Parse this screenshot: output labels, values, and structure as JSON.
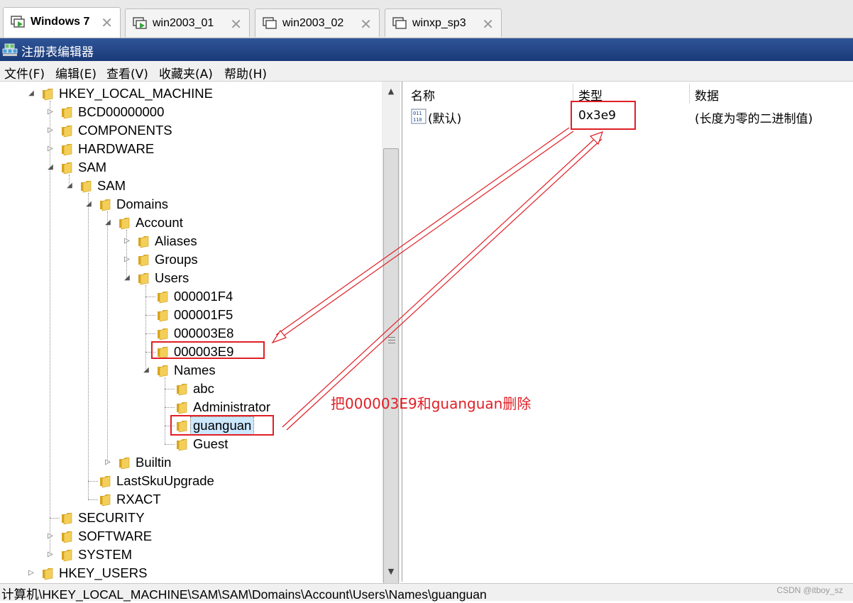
{
  "vm_tabs": [
    {
      "label": "Windows 7",
      "active": true
    },
    {
      "label": "win2003_01",
      "active": false
    },
    {
      "label": "win2003_02",
      "active": false
    },
    {
      "label": "winxp_sp3",
      "active": false
    }
  ],
  "window": {
    "title": "注册表编辑器"
  },
  "menu": [
    "文件(F)",
    "编辑(E)",
    "查看(V)",
    "收藏夹(A)",
    "帮助(H)"
  ],
  "tree": {
    "nodes": [
      {
        "label": "HKEY_LOCAL_MACHINE",
        "depth": 0,
        "expander": "expanded"
      },
      {
        "label": "BCD00000000",
        "depth": 1,
        "expander": "collapsed"
      },
      {
        "label": "COMPONENTS",
        "depth": 1,
        "expander": "collapsed"
      },
      {
        "label": "HARDWARE",
        "depth": 1,
        "expander": "collapsed"
      },
      {
        "label": "SAM",
        "depth": 1,
        "expander": "expanded"
      },
      {
        "label": "SAM",
        "depth": 2,
        "expander": "expanded"
      },
      {
        "label": "Domains",
        "depth": 3,
        "expander": "expanded"
      },
      {
        "label": "Account",
        "depth": 4,
        "expander": "expanded"
      },
      {
        "label": "Aliases",
        "depth": 5,
        "expander": "collapsed"
      },
      {
        "label": "Groups",
        "depth": 5,
        "expander": "collapsed"
      },
      {
        "label": "Users",
        "depth": 5,
        "expander": "expanded"
      },
      {
        "label": "000001F4",
        "depth": 6,
        "expander": "none"
      },
      {
        "label": "000001F5",
        "depth": 6,
        "expander": "none"
      },
      {
        "label": "000003E8",
        "depth": 6,
        "expander": "none"
      },
      {
        "label": "000003E9",
        "depth": 6,
        "expander": "none"
      },
      {
        "label": "Names",
        "depth": 6,
        "expander": "expanded"
      },
      {
        "label": "abc",
        "depth": 7,
        "expander": "none"
      },
      {
        "label": "Administrator",
        "depth": 7,
        "expander": "none"
      },
      {
        "label": "guanguan",
        "depth": 7,
        "expander": "none",
        "selected": true
      },
      {
        "label": "Guest",
        "depth": 7,
        "expander": "none"
      },
      {
        "label": "Builtin",
        "depth": 4,
        "expander": "collapsed"
      },
      {
        "label": "LastSkuUpgrade",
        "depth": 3,
        "expander": "none"
      },
      {
        "label": "RXACT",
        "depth": 3,
        "expander": "none"
      },
      {
        "label": "SECURITY",
        "depth": 1,
        "expander": "none"
      },
      {
        "label": "SOFTWARE",
        "depth": 1,
        "expander": "collapsed"
      },
      {
        "label": "SYSTEM",
        "depth": 1,
        "expander": "collapsed"
      },
      {
        "label": "HKEY_USERS",
        "depth": 0,
        "expander": "collapsed"
      }
    ]
  },
  "values_list": {
    "columns": [
      "名称",
      "类型",
      "数据"
    ],
    "rows": [
      {
        "name": "(默认)",
        "type": "0x3e9",
        "data": "(长度为零的二进制值)",
        "icon": "binary-value-icon"
      }
    ]
  },
  "status_bar": {
    "path": "计算机\\HKEY_LOCAL_MACHINE\\SAM\\SAM\\Domains\\Account\\Users\\Names\\guanguan"
  },
  "annotation": {
    "text": "把000003E9和guanguan删除",
    "color": "#e01f26"
  },
  "watermark": "CSDN @itboy_sz",
  "colors": {
    "titlebar": "#1f4183",
    "annotation_red": "#e01f26",
    "selection": "#cce8ff"
  }
}
